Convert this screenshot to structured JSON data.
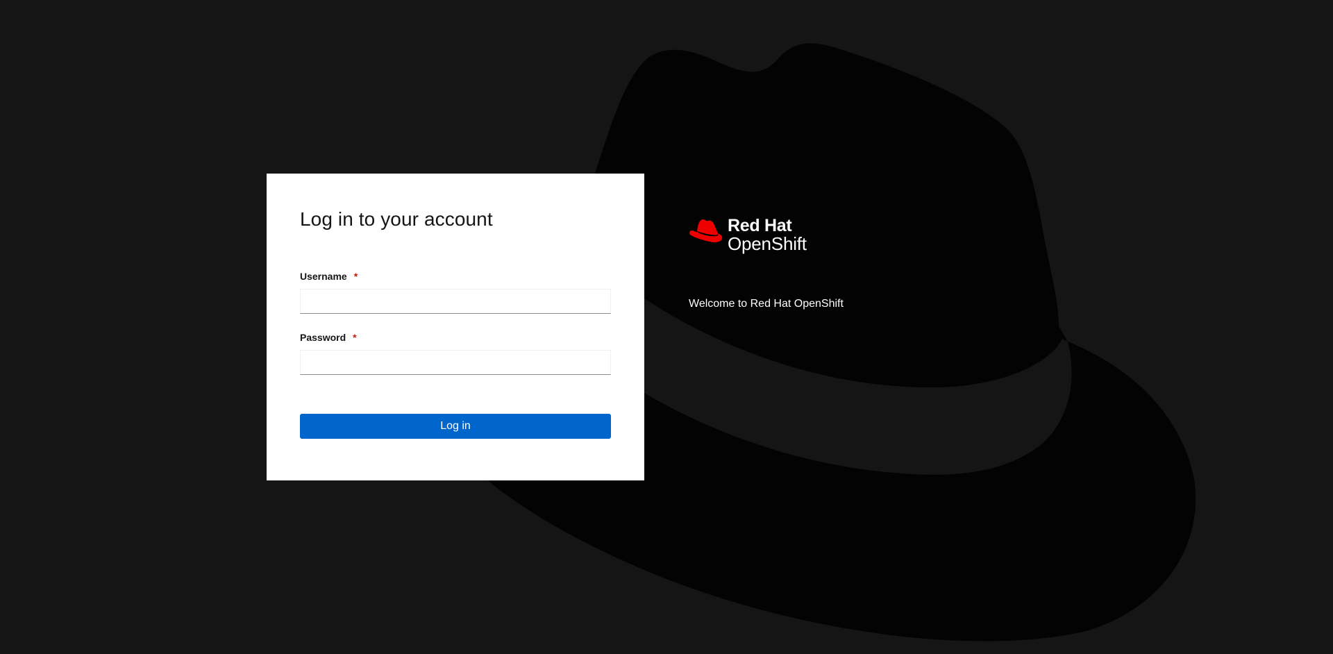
{
  "login": {
    "title": "Log in to your account",
    "username_label": "Username",
    "username_required": "*",
    "username_value": "",
    "password_label": "Password",
    "password_required": "*",
    "password_value": "",
    "submit_label": "Log in"
  },
  "brand": {
    "line1": "Red Hat",
    "line2": "OpenShift",
    "welcome": "Welcome to Red Hat OpenShift",
    "logo_icon": "red-hat-fedora-icon"
  },
  "colors": {
    "background": "#151515",
    "hat_shape": "#030303",
    "brand_red": "#ee0000",
    "primary_button": "#0066cc",
    "required_star": "#c9190b"
  }
}
